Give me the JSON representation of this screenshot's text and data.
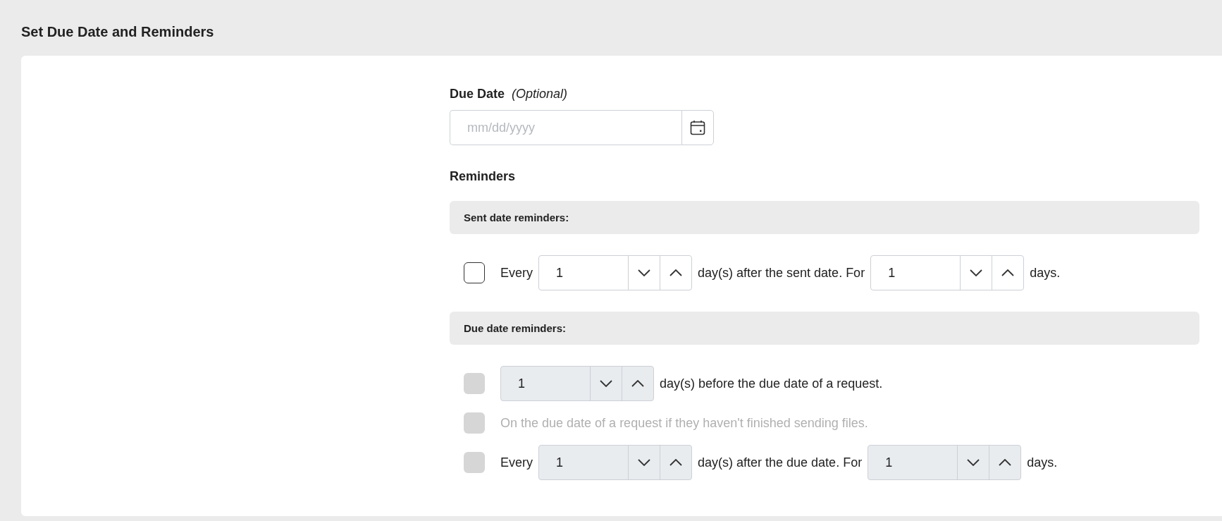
{
  "page_title": "Set Due Date and Reminders",
  "due_date": {
    "label": "Due Date",
    "optional": "(Optional)",
    "placeholder": "mm/dd/yyyy"
  },
  "reminders_title": "Reminders",
  "sections": [
    {
      "title": "Sent date reminders:",
      "rows": [
        {
          "checked": false,
          "disabled": false,
          "parts": [
            {
              "kind": "text",
              "text": "Every",
              "dimmed": false
            },
            {
              "kind": "stepper",
              "value": "1"
            },
            {
              "kind": "text",
              "text": "day(s) after the sent date. For",
              "dimmed": false
            },
            {
              "kind": "stepper",
              "value": "1"
            },
            {
              "kind": "text",
              "text": "days.",
              "dimmed": false
            }
          ]
        }
      ]
    },
    {
      "title": "Due date reminders:",
      "rows": [
        {
          "checked": false,
          "disabled": true,
          "parts": [
            {
              "kind": "stepper",
              "value": "1"
            },
            {
              "kind": "text",
              "text": "day(s) before the due date of a request.",
              "dimmed": false
            }
          ]
        },
        {
          "checked": false,
          "disabled": true,
          "parts": [
            {
              "kind": "text",
              "text": "On the due date of a request if they haven't finished sending files.",
              "dimmed": true
            }
          ]
        },
        {
          "checked": false,
          "disabled": true,
          "parts": [
            {
              "kind": "text",
              "text": "Every",
              "dimmed": false
            },
            {
              "kind": "stepper",
              "value": "1"
            },
            {
              "kind": "text",
              "text": "day(s) after the due date. For",
              "dimmed": false
            },
            {
              "kind": "stepper",
              "value": "1"
            },
            {
              "kind": "text",
              "text": "days.",
              "dimmed": false
            }
          ]
        }
      ]
    }
  ]
}
